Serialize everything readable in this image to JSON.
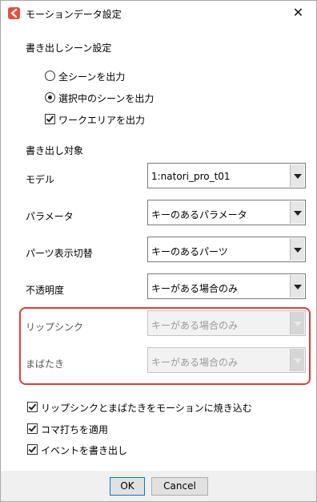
{
  "window": {
    "title": "モーションデータ設定",
    "close_glyph": "✕"
  },
  "scene_section": {
    "label": "書き出しシーン設定",
    "options": [
      {
        "label": "全シーンを出力",
        "checked": false
      },
      {
        "label": "選択中のシーンを出力",
        "checked": true
      }
    ],
    "workarea": {
      "label": "ワークエリアを出力",
      "checked": true
    }
  },
  "target_section": {
    "label": "書き出し対象",
    "fields": [
      {
        "label": "モデル",
        "value": "1:natori_pro_t01",
        "enabled": true
      },
      {
        "label": "パラメータ",
        "value": "キーのあるパラメータ",
        "enabled": true
      },
      {
        "label": "パーツ表示切替",
        "value": "キーのあるパーツ",
        "enabled": true
      },
      {
        "label": "不透明度",
        "value": "キーがある場合のみ",
        "enabled": true
      },
      {
        "label": "リップシンク",
        "value": "キーがある場合のみ",
        "enabled": false
      },
      {
        "label": "まばたき",
        "value": "キーがある場合のみ",
        "enabled": false
      }
    ]
  },
  "options": [
    {
      "label": "リップシンクとまばたきをモーションに焼き込む",
      "checked": true
    },
    {
      "label": "コマ打ちを適用",
      "checked": true
    },
    {
      "label": "イベントを書き出し",
      "checked": true
    }
  ],
  "buttons": {
    "ok": "OK",
    "cancel": "Cancel"
  },
  "colors": {
    "highlight": "#e53a3a",
    "app_icon": "#e8503a",
    "default_button_border": "#0078d7"
  }
}
